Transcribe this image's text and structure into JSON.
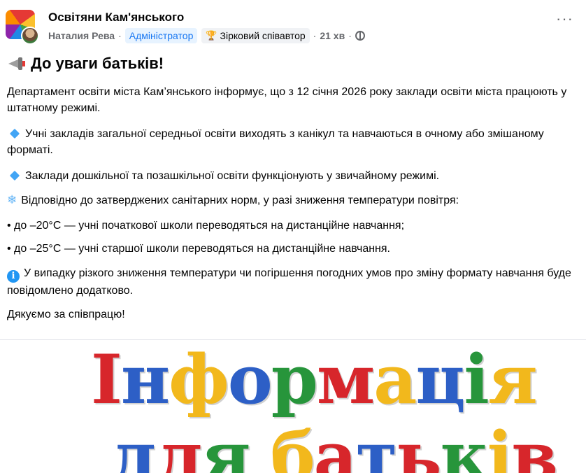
{
  "post": {
    "group_name": "Освітяни Кам'янського",
    "author": "Наталия Рева",
    "separator": "·",
    "role_badge": "Адміністратор",
    "star_badge": "Зірковий співавтор",
    "time": "21 хв",
    "more_label": "···",
    "title": "До уваги батьків!",
    "p1": "Департамент освіти міста Кам’янського інформує, що з 12 січня 2026 року заклади освіти міста працюють у штатному режимі.",
    "p2": "Учні закладів загальної середньої освіти виходять з канікул та навчаються в очному або змішаному форматі.",
    "p3": "Заклади дошкільної та позашкільної освіти функціонують у звичайному режимі.",
    "p4": "Відповідно до затверджених санітарних норм, у разі зниження температури повітря:",
    "p5": "• до –20°C — учні початкової школи переводяться на дистанційне навчання;",
    "p6": "• до –25°C — учні старшої школи переводяться на дистанційне навчання.",
    "p7": "У випадку різкого зниження температури чи погіршення погодних умов про зміну формату навчання буде повідомлено додатково.",
    "p8": "Дякуємо за співпрацю!"
  },
  "image": {
    "line1_letters": [
      "І",
      "н",
      "ф",
      "о",
      "р",
      "м",
      "а",
      "ц",
      "і",
      "я"
    ],
    "line2_letters": [
      "д",
      "л",
      "я",
      " ",
      "б",
      "а",
      "т",
      "ь",
      "к",
      "і",
      "в"
    ],
    "colors": {
      "red": "#d7262b",
      "blue": "#2d5fc6",
      "yellow": "#f2b81c",
      "green": "#27953b"
    }
  },
  "icons": {
    "megaphone": "megaphone-icon",
    "diamond": "blue-diamond-icon",
    "snowflake": "snowflake-icon",
    "info": "info-icon",
    "globe": "globe-icon",
    "trophy": "trophy-icon"
  }
}
